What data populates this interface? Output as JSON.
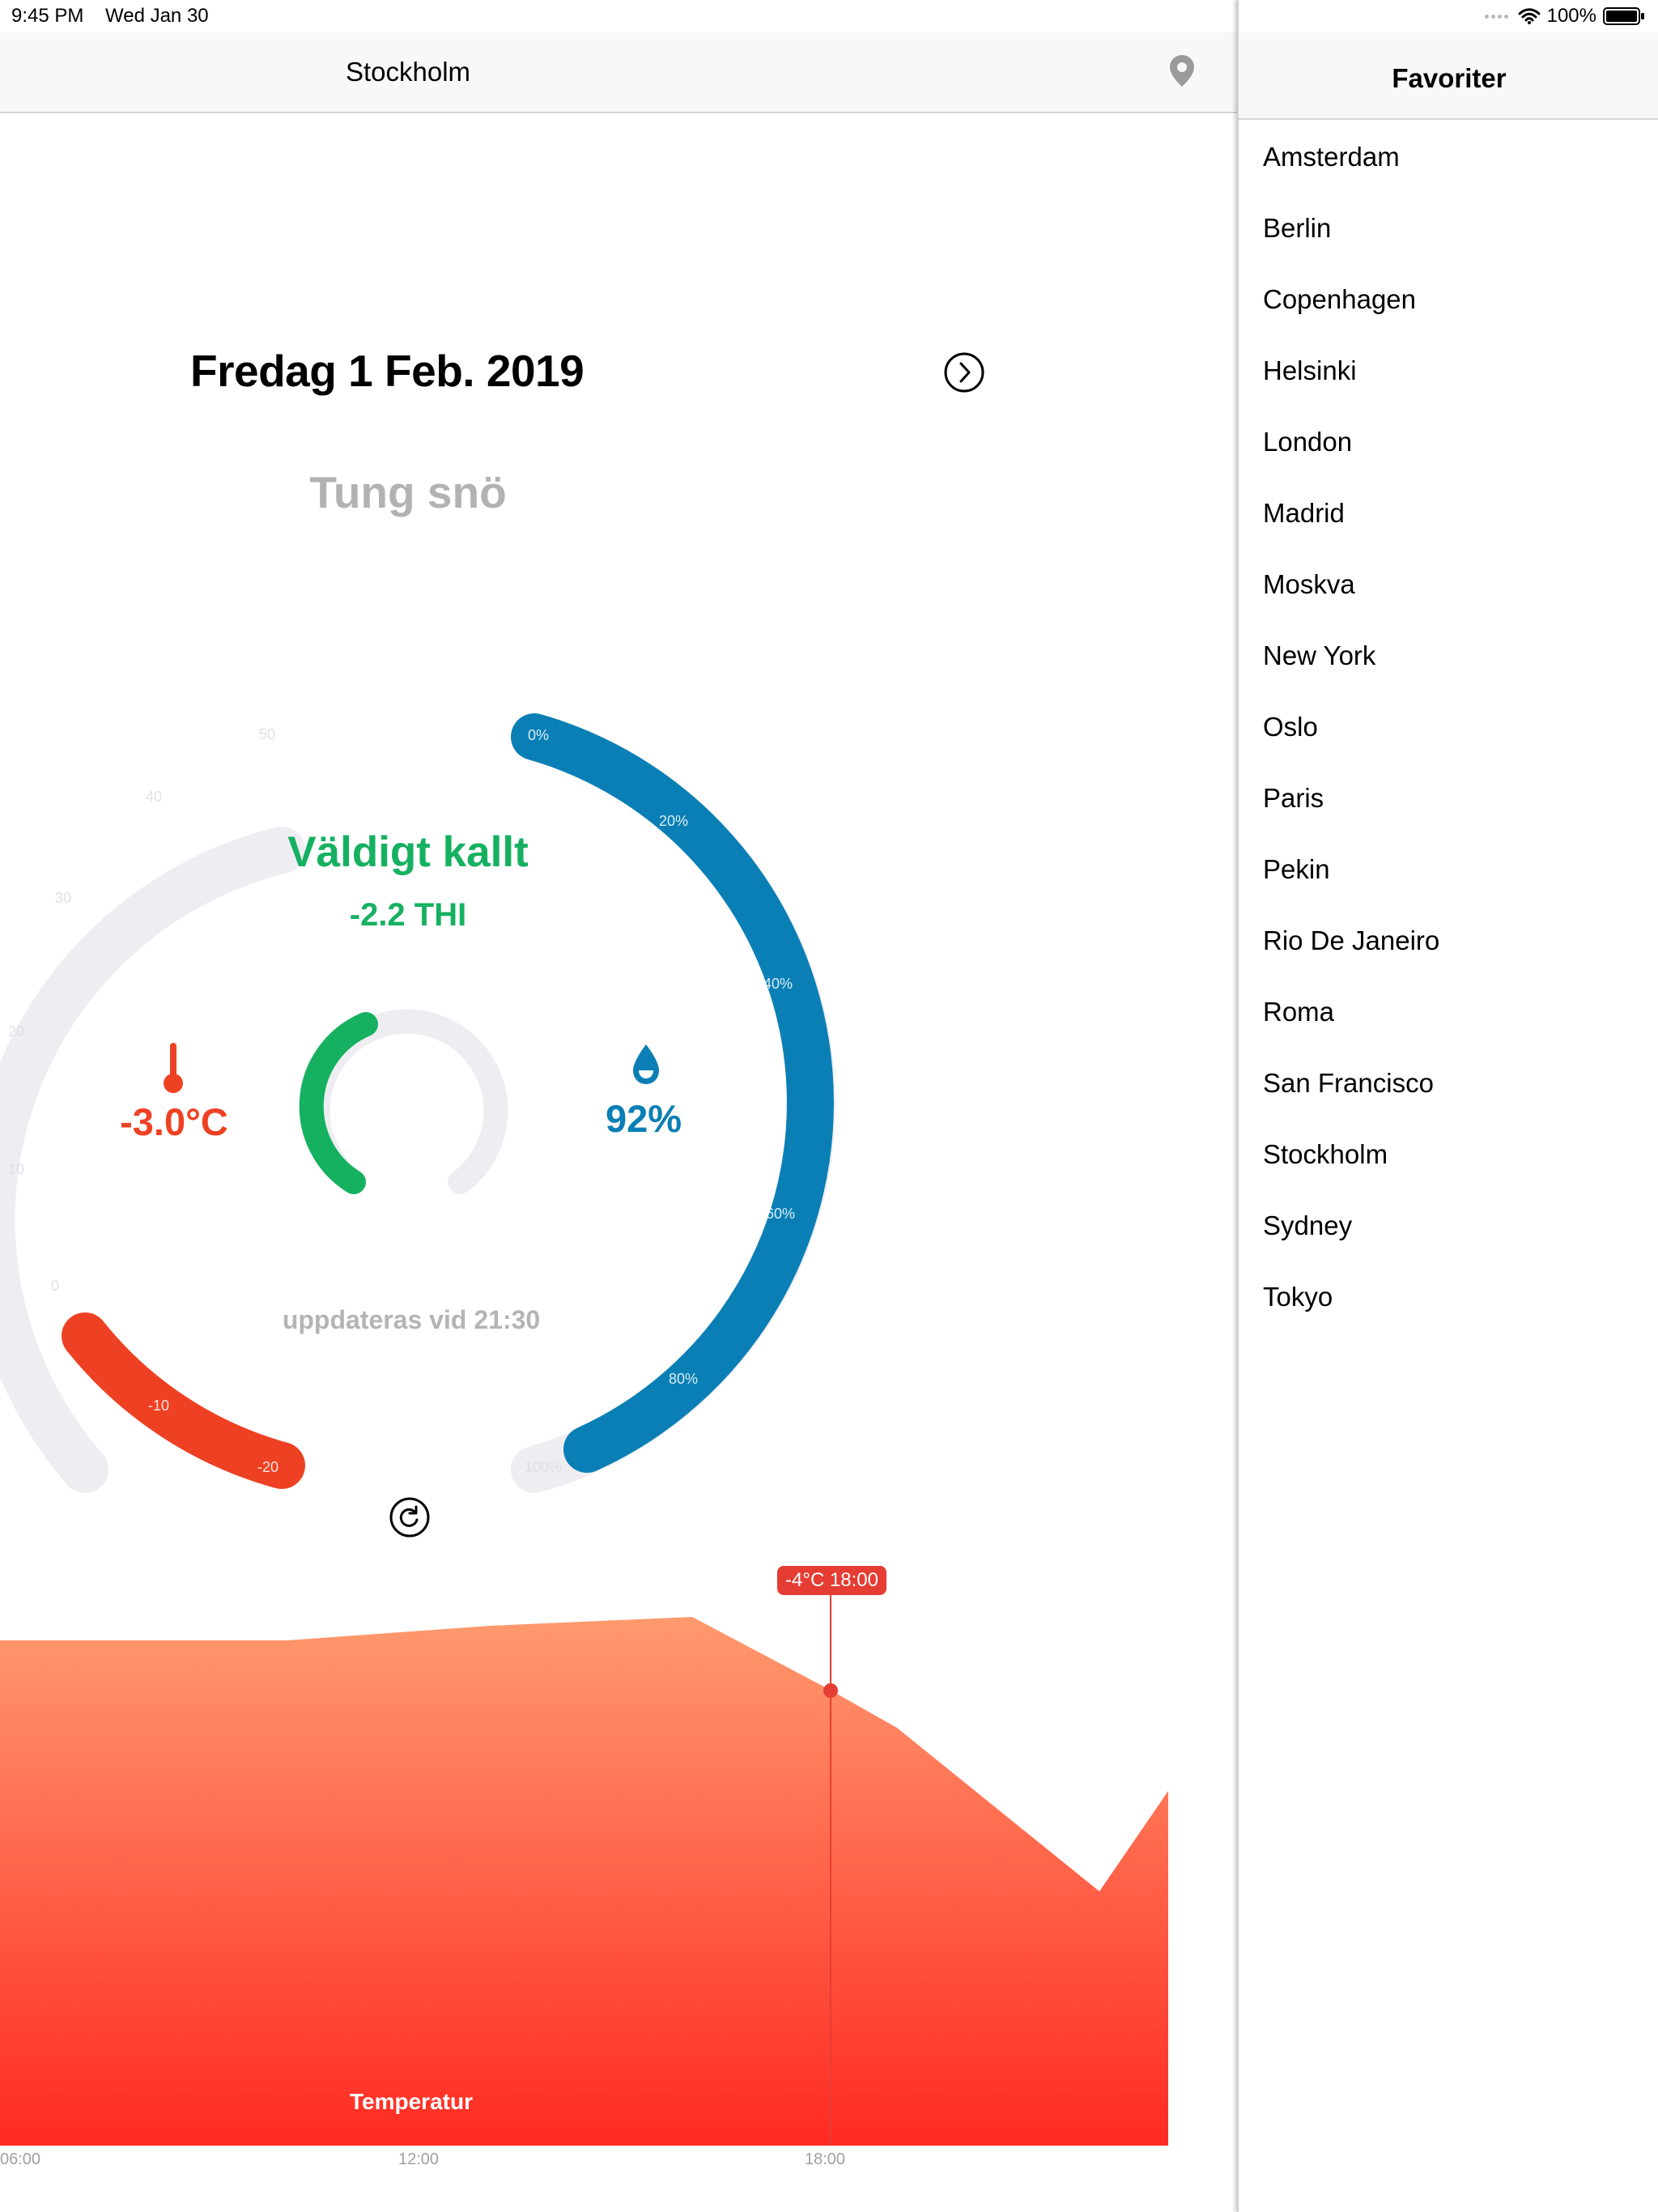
{
  "status_bar": {
    "time": "9:45 PM",
    "date": "Wed Jan 30",
    "battery": "100%",
    "icons": [
      "cellular-signal-icon",
      "wifi-icon",
      "battery-icon"
    ]
  },
  "nav": {
    "title": "Stockholm",
    "location_icon": "location-pin-icon"
  },
  "forecast": {
    "date": "Fredag 1 Feb. 2019",
    "next_icon": "chevron-right-circle-icon",
    "condition": "Tung snö",
    "comfort_label": "Väldigt kallt",
    "thi": "-2.2 THI",
    "temperature": "-3.0°C",
    "humidity": "92%",
    "update_text": "uppdateras vid 21:30",
    "refresh_icon": "refresh-icon"
  },
  "colors": {
    "temperature": "#ee4123",
    "humidity": "#0a7fb5",
    "comfort": "#16b061",
    "gauge_track": "#eeeef2",
    "chart_top": "#ff9a6e",
    "chart_bottom": "#ff2a22"
  },
  "gauges": {
    "temperature_scale": [
      "-20",
      "-10",
      "0",
      "10",
      "20",
      "30",
      "40",
      "50"
    ],
    "humidity_scale": [
      "0%",
      "20%",
      "40%",
      "60%",
      "80%",
      "100%"
    ],
    "temperature_value": -3.0,
    "humidity_value": 92,
    "thi_value": -2.2
  },
  "chart": {
    "tooltip": "-4°C 18:00",
    "label": "Temperatur",
    "x_labels": [
      "06:00",
      "12:00",
      "18:00"
    ]
  },
  "sidebar": {
    "title": "Favoriter",
    "cities": [
      "Amsterdam",
      "Berlin",
      "Copenhagen",
      "Helsinki",
      "London",
      "Madrid",
      "Moskva",
      "New York",
      "Oslo",
      "Paris",
      "Pekin",
      "Rio De Janeiro",
      "Roma",
      "San Francisco",
      "Stockholm",
      "Sydney",
      "Tokyo"
    ]
  }
}
